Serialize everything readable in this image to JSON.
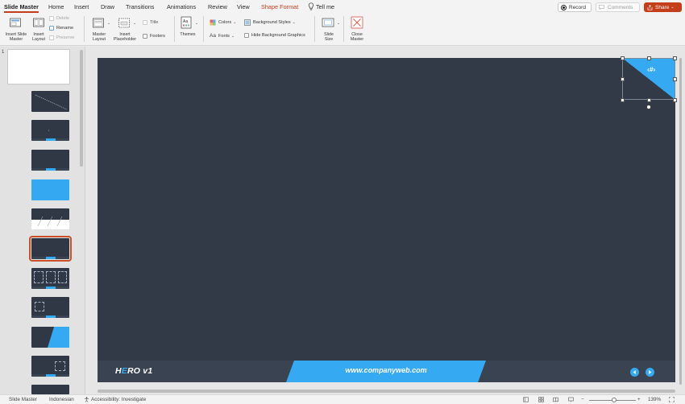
{
  "tabs": [
    {
      "label": "Slide Master",
      "active": true
    },
    {
      "label": "Home"
    },
    {
      "label": "Insert"
    },
    {
      "label": "Draw"
    },
    {
      "label": "Transitions"
    },
    {
      "label": "Animations"
    },
    {
      "label": "Review"
    },
    {
      "label": "View"
    },
    {
      "label": "Shape Format",
      "accent": true
    },
    {
      "label": "Tell me"
    }
  ],
  "topbar": {
    "record": "Record",
    "comments": "Comments",
    "share": "Share"
  },
  "ribbon": {
    "insert_slide_master": [
      "Insert Slide",
      "Master"
    ],
    "insert_layout": [
      "Insert",
      "Layout"
    ],
    "delete": "Delete",
    "rename": "Rename",
    "preserve": "Preserve",
    "master_layout": [
      "Master",
      "Layout"
    ],
    "insert_placeholder": [
      "Insert",
      "Placeholder"
    ],
    "title": "Title",
    "footers": "Footers",
    "themes": "Themes",
    "colors": "Colors",
    "fonts": "Fonts",
    "background_styles": "Background Styles",
    "hide_background_graphics": "Hide Background Graphics",
    "slide_size": [
      "Slide",
      "Size"
    ],
    "close_master": [
      "Close",
      "Master"
    ]
  },
  "thumbnails": {
    "master_number": "1"
  },
  "slide": {
    "logo_prefix": "H",
    "logo_accent": "E",
    "logo_rest": "RO v1",
    "website": "www.companyweb.com",
    "slide_number": "‹#›"
  },
  "status": {
    "view": "Slide Master",
    "language": "Indonesian",
    "accessibility": "Accessibility: Investigate",
    "zoom": "139%"
  },
  "colors": {
    "accent": "#c43e1c",
    "slide_bg": "#323a47",
    "brand_blue": "#36a9f3"
  },
  "icons": [
    "insert-slide-master-icon",
    "insert-layout-icon",
    "master-layout-icon",
    "insert-placeholder-icon",
    "themes-icon",
    "colors-icon",
    "fonts-icon",
    "slide-size-icon",
    "close-master-icon",
    "lightbulb-icon",
    "record-icon",
    "comment-icon",
    "share-icon",
    "accessibility-icon",
    "normal-view-icon",
    "slide-sorter-icon",
    "reading-view-icon",
    "fit-slide-icon"
  ]
}
